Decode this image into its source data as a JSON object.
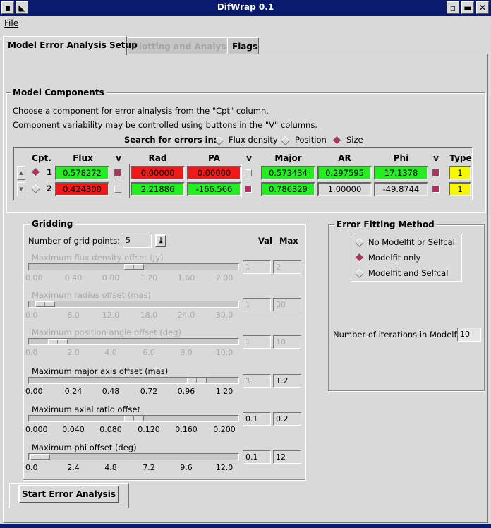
{
  "window": {
    "title": "DifWrap 0.1"
  },
  "menu": {
    "file": "File"
  },
  "tabs": [
    {
      "label": "Model Error Analysis Setup",
      "state": "active"
    },
    {
      "label": "Plotting and Analysis",
      "state": "disabled"
    },
    {
      "label": "Flags",
      "state": "inactive"
    }
  ],
  "components": {
    "title": "Model Components",
    "intro1": "Choose a component for error alnalysis from the \"Cpt\" column.",
    "intro2": "Component variability may be controlled using buttons in the \"V\" columns.",
    "search_label": "Search for errors in:",
    "search_options": [
      "Flux density",
      "Position",
      "Size"
    ],
    "search_selected": "Size",
    "headers": {
      "cpt": "Cpt.",
      "flux": "Flux",
      "v": "v",
      "rad": "Rad",
      "pa": "PA",
      "major": "Major",
      "ar": "AR",
      "phi": "Phi",
      "type": "Type"
    },
    "rows": [
      {
        "cpt": "1",
        "selected": true,
        "flux": "0.578272",
        "flux_color": "green",
        "v1": true,
        "rad": "0.00000",
        "rad_color": "red",
        "pa": "0.00000",
        "pa_color": "red",
        "v2": false,
        "major": "0.573434",
        "major_color": "green",
        "ar": "0.297595",
        "ar_color": "green",
        "phi": "17.1378",
        "phi_color": "green",
        "v3": true,
        "type": "1"
      },
      {
        "cpt": "2",
        "selected": false,
        "flux": "0.424300",
        "flux_color": "red",
        "v1": false,
        "rad": "2.21886",
        "rad_color": "green",
        "pa": "-166.566",
        "pa_color": "green",
        "v2": true,
        "major": "0.786329",
        "major_color": "green",
        "ar": "1.00000",
        "ar_color": "gray",
        "phi": "-49.8744",
        "phi_color": "gray",
        "v3": true,
        "type": "1"
      }
    ],
    "colors": {
      "green": "#22ee22",
      "red": "#f01818",
      "gray": "#d9d9d9",
      "yellow": "#f7f700",
      "selected": "#b03060"
    }
  },
  "gridding": {
    "title": "Gridding",
    "num_points_label": "Number of grid points:",
    "num_points": "5",
    "val_header": "Val",
    "max_header": "Max",
    "sliders": [
      {
        "label": "Maximum flux density offset (Jy)",
        "enabled": false,
        "ticks": [
          "0.00",
          "0.40",
          "0.80",
          "1.20",
          "1.60",
          "2.00"
        ],
        "val": "1",
        "max": "2",
        "fraction": 0.5
      },
      {
        "label": "Maximum radius offset (mas)",
        "enabled": false,
        "ticks": [
          "0.0",
          "6.0",
          "12.0",
          "18.0",
          "24.0",
          "30.0"
        ],
        "val": "1",
        "max": "30",
        "fraction": 0.033
      },
      {
        "label": "Maximum position angle offset (deg)",
        "enabled": false,
        "ticks": [
          "0.0",
          "2.0",
          "4.0",
          "6.0",
          "8.0",
          "10.0"
        ],
        "val": "1",
        "max": "10",
        "fraction": 0.1
      },
      {
        "label": "Maximum major axis offset (mas)",
        "enabled": true,
        "ticks": [
          "0.00",
          "0.24",
          "0.48",
          "0.72",
          "0.96",
          "1.20"
        ],
        "val": "1",
        "max": "1.2",
        "fraction": 0.833
      },
      {
        "label": "Maximum axial ratio offset",
        "enabled": true,
        "ticks": [
          "0.000",
          "0.040",
          "0.080",
          "0.120",
          "0.160",
          "0.200"
        ],
        "val": "0.1",
        "max": "0.2",
        "fraction": 0.5
      },
      {
        "label": "Maximum phi offset (deg)",
        "enabled": true,
        "ticks": [
          "0.0",
          "2.4",
          "4.8",
          "7.2",
          "9.6",
          "12.0"
        ],
        "val": "0.1",
        "max": "12",
        "fraction": 0.008
      }
    ]
  },
  "error_fitting": {
    "title": "Error Fitting Method",
    "options": [
      "No Modelfit or Selfcal",
      "Modelfit only",
      "Modelfit and Selfcal"
    ],
    "selected": "Modelfit only",
    "iterations_label": "Number of iterations in Modelfit:",
    "iterations": "10"
  },
  "start_button": "Start Error Analysis"
}
